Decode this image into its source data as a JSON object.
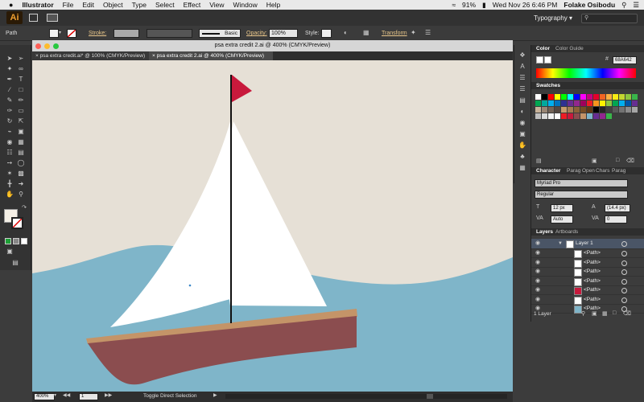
{
  "menubar": {
    "apple": "",
    "app_name": "Illustrator",
    "menus": [
      "File",
      "Edit",
      "Object",
      "Type",
      "Select",
      "Effect",
      "View",
      "Window",
      "Help"
    ],
    "battery": "91%",
    "datetime": "Wed Nov 26  6:46 PM",
    "user": "Folake Osibodu"
  },
  "appbar": {
    "logo": "Ai",
    "workspace": "Typography",
    "search_placeholder": ""
  },
  "control": {
    "selection": "Path",
    "stroke_label": "Stroke:",
    "brush": "Basic",
    "opacity_label": "Opacity:",
    "opacity_value": "100%",
    "style_label": "Style:",
    "transform_label": "Transform"
  },
  "document": {
    "title": "psa extra credit 2.ai @ 400% (CMYK/Preview)",
    "tabs": [
      {
        "label": "psa extra credit.ai* @ 100% (CMYK/Preview)",
        "active": false
      },
      {
        "label": "psa extra credit 2.ai @ 400% (CMYK/Preview)",
        "active": true
      }
    ]
  },
  "status": {
    "zoom": "400%",
    "artboard": "1",
    "tool_hint": "Toggle Direct Selection"
  },
  "color_panel": {
    "tabs": [
      "Color",
      "Color Guide"
    ],
    "hex": "68A642"
  },
  "swatches_panel": {
    "title": "Swatches"
  },
  "character_panel": {
    "tabs": [
      "Character",
      "Parag",
      "Open",
      "Chars",
      "Parag"
    ],
    "font": "Myriad Pro",
    "style": "Regular",
    "size": "12 px",
    "leading": "(14.4 px)",
    "kerning": "Auto",
    "tracking": "0"
  },
  "layers_panel": {
    "tabs": [
      "Layers",
      "Artboards"
    ],
    "layer_name": "Layer 1",
    "items": [
      "<Path>",
      "<Path>",
      "<Path>",
      "<Path>",
      "<Path>",
      "<Path>",
      "<Path>"
    ],
    "footer": "1 Layer"
  },
  "colors": {
    "sky": "#e6e0d6",
    "sea": "#7fb5c9",
    "sail": "#ffffff",
    "flag": "#c8193c",
    "deck": "#c49468",
    "hull": "#8b4d4f",
    "mast": "#111111"
  }
}
